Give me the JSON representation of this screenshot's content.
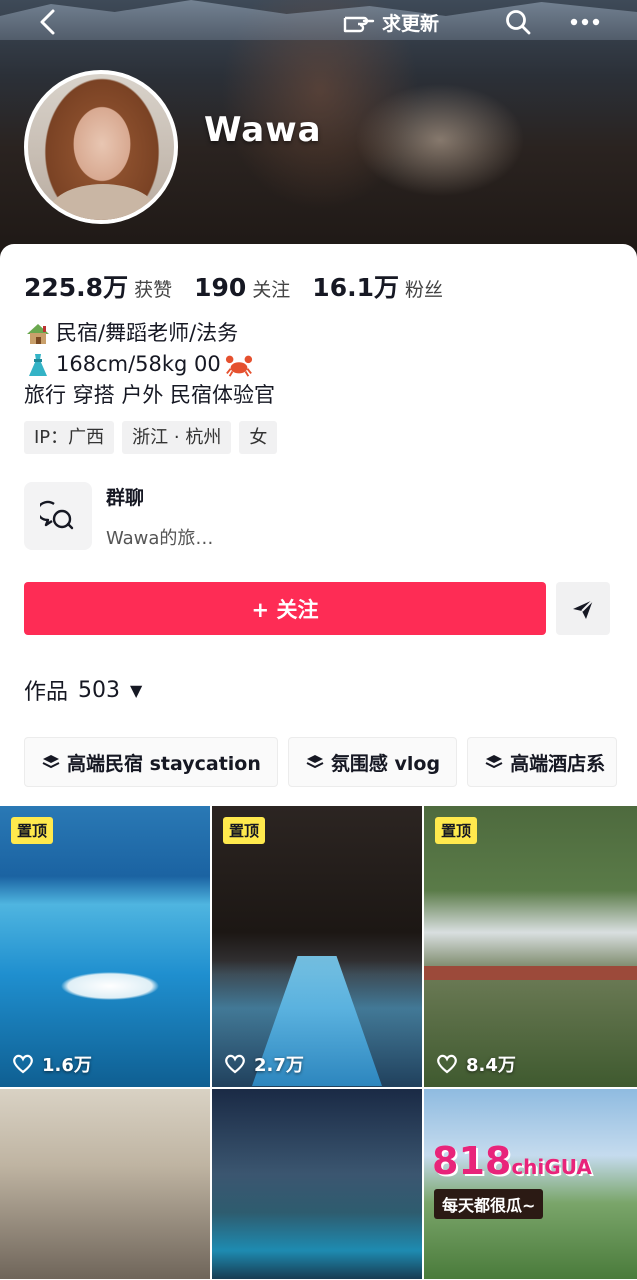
{
  "header": {
    "refresh_label": "求更新",
    "username": "Wawa"
  },
  "stats": [
    {
      "value": "225.8万",
      "label": "获赞"
    },
    {
      "value": "190",
      "label": "关注"
    },
    {
      "value": "16.1万",
      "label": "粉丝"
    }
  ],
  "bio": {
    "line1": "民宿/舞蹈老师/法务",
    "line2": "168cm/58kg  00",
    "line3": "旅行 穿搭 户外 民宿体验官"
  },
  "tags": [
    "IP：广西",
    "浙江 · 杭州",
    "女"
  ],
  "group": {
    "title": "群聊",
    "subtitle": "Wawa的旅…"
  },
  "follow_button": "+ 关注",
  "works": {
    "label": "作品",
    "count": "503"
  },
  "collections": [
    "高端民宿 staycation",
    "氛围感 vlog",
    "高端酒店系"
  ],
  "grid": {
    "pin_label": "置顶",
    "tiles": [
      {
        "likes": "1.6万",
        "pinned": true
      },
      {
        "likes": "2.7万",
        "pinned": true
      },
      {
        "likes": "8.4万",
        "pinned": true
      },
      {
        "likes": "",
        "pinned": false
      },
      {
        "likes": "",
        "pinned": false
      },
      {
        "likes": "",
        "pinned": false
      }
    ],
    "ad": {
      "logo": "818",
      "logo_suffix": "chiGUA",
      "banner": "每天都很瓜~"
    }
  },
  "colors": {
    "follow": "#fe2c55",
    "pin": "#ffe94d"
  }
}
